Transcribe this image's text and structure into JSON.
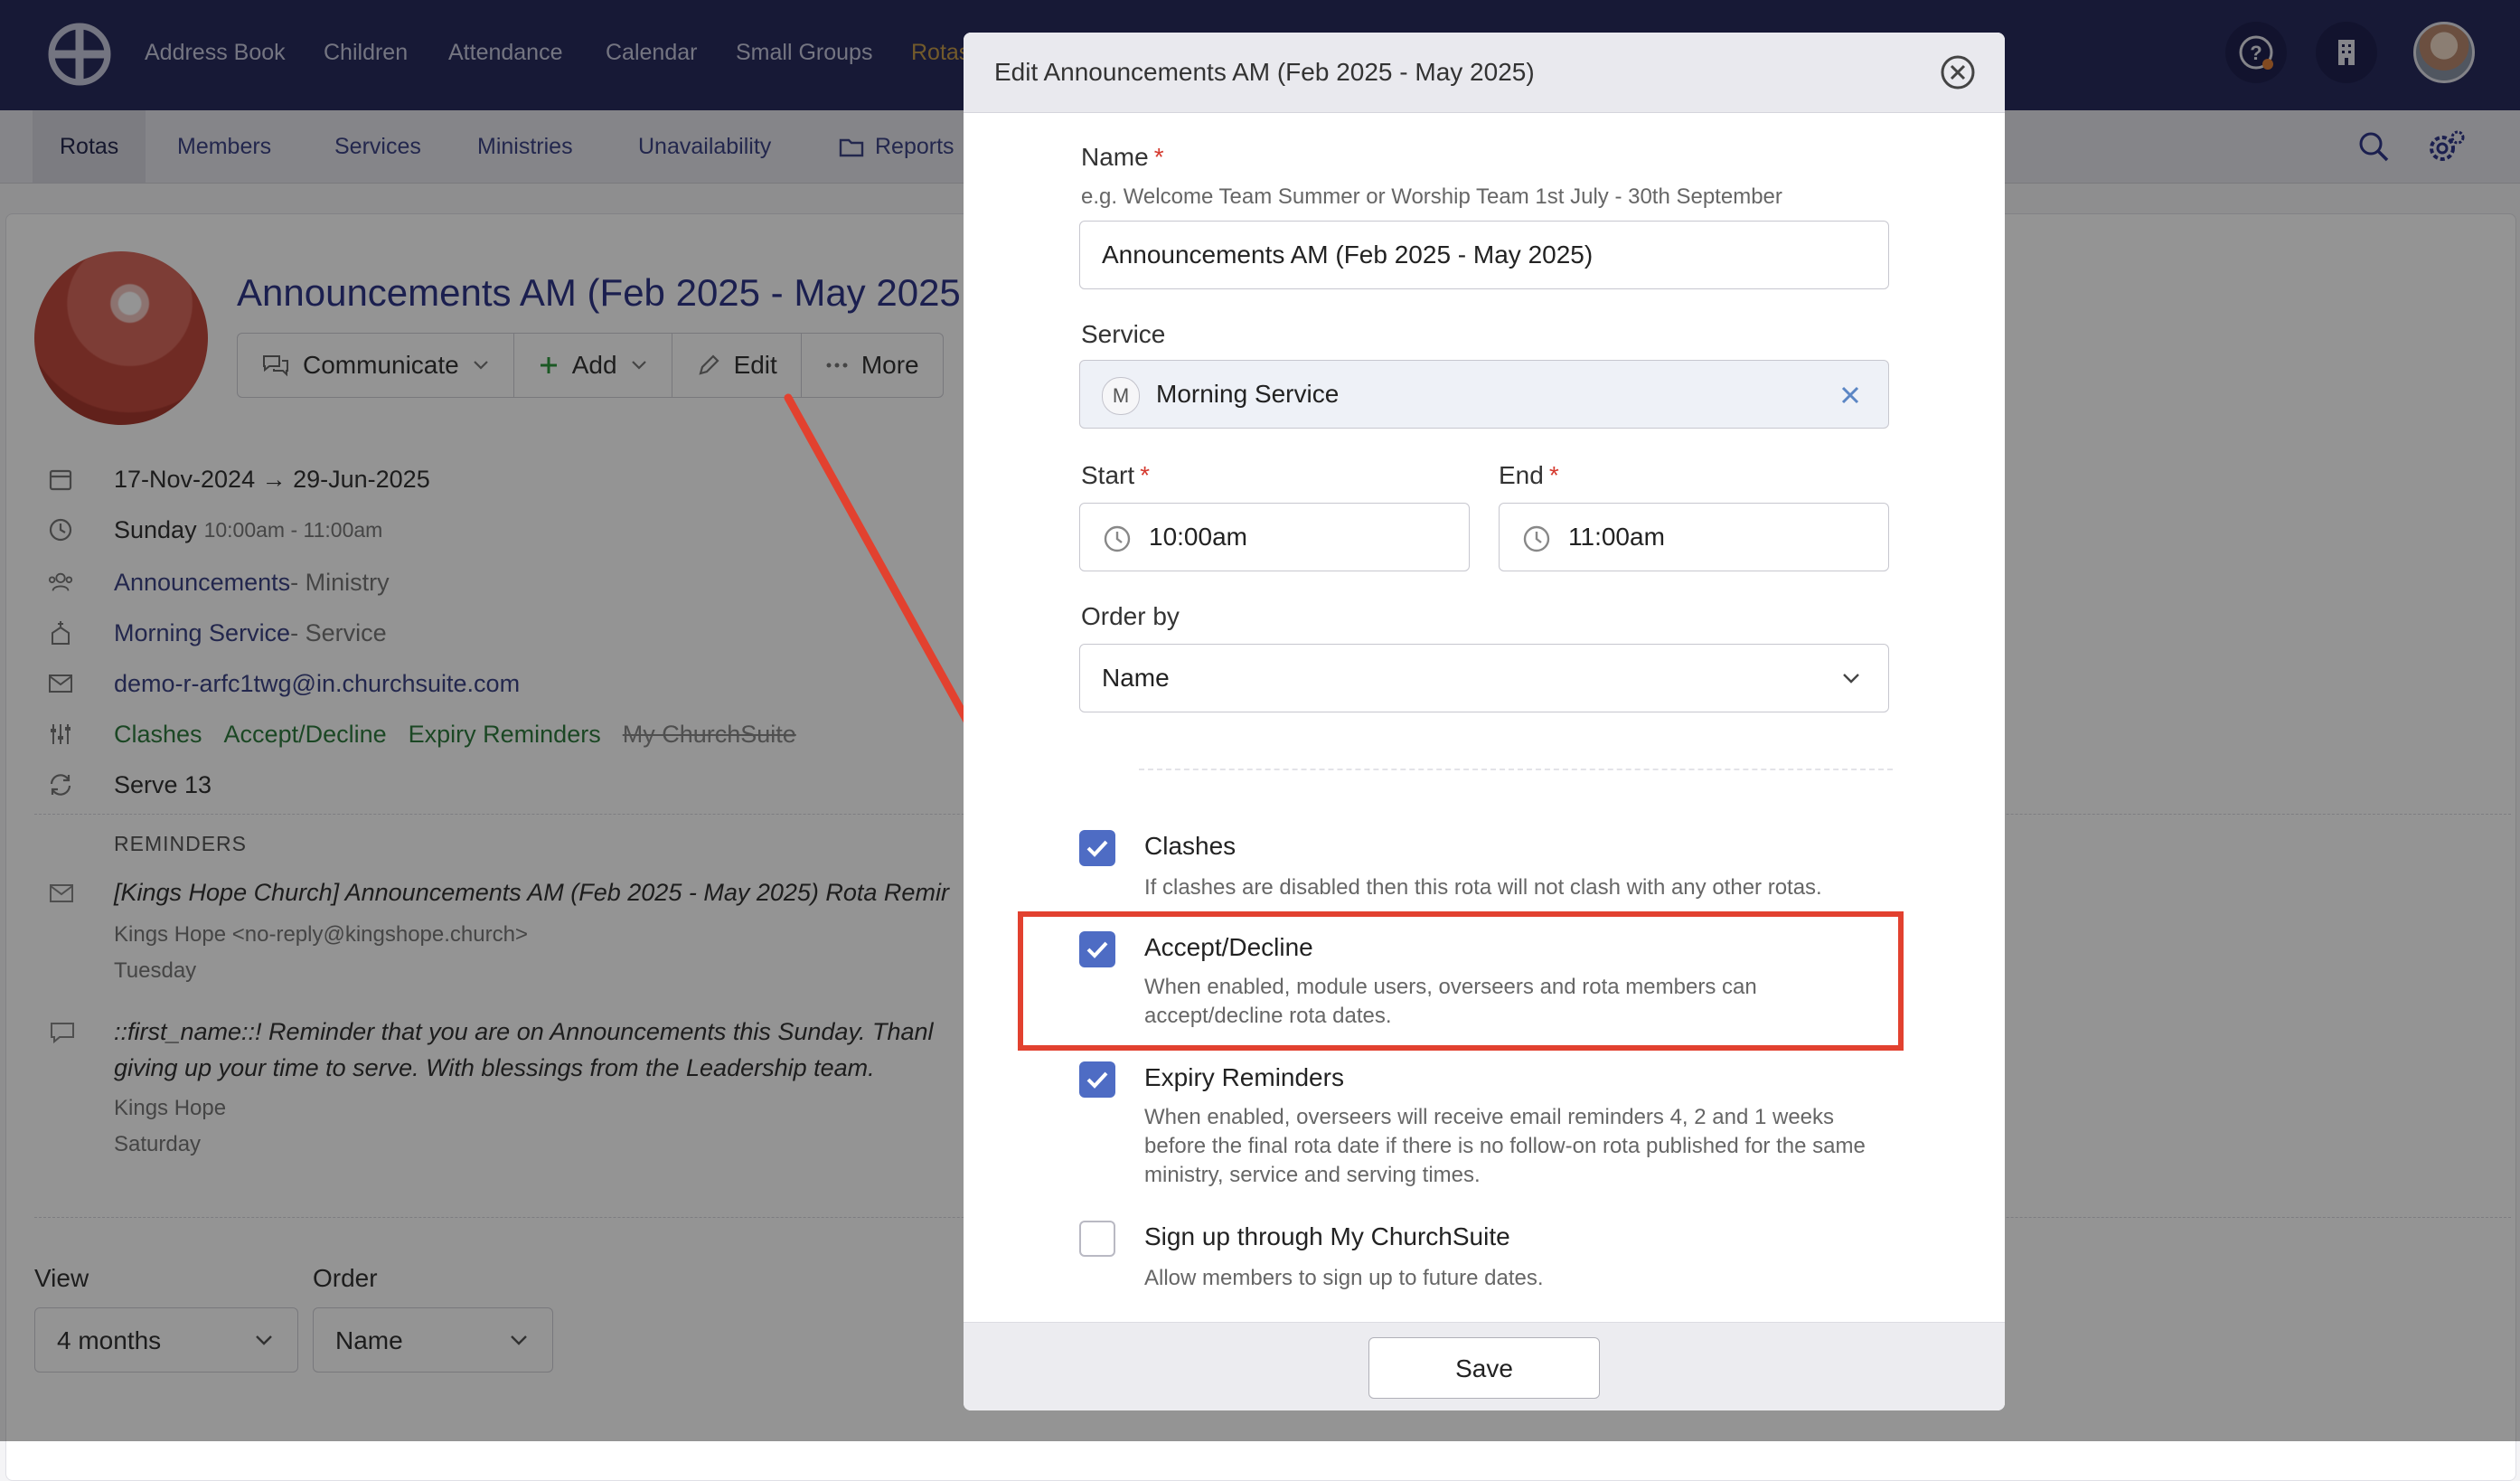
{
  "topnav": {
    "items": [
      "Address Book",
      "Children",
      "Attendance",
      "Calendar",
      "Small Groups",
      "Rotas"
    ],
    "help_icon": "help-icon",
    "building_icon": "building-icon"
  },
  "subnav": {
    "items": [
      "Rotas",
      "Members",
      "Services",
      "Ministries",
      "Unavailability",
      "Reports"
    ]
  },
  "rota": {
    "title": "Announcements AM (Feb 2025 - May 2025",
    "actions": [
      "Communicate",
      "Add",
      "Edit",
      "More"
    ],
    "dates": "17-Nov-2024 → 29-Jun-2025",
    "day": "Sunday",
    "time": "10:00am - 11:00am",
    "ministry_link": "Announcements",
    "ministry_suffix": " - Ministry",
    "service_link": "Morning Service",
    "service_suffix": " - Service",
    "email": "demo-r-arfc1twg@in.churchsuite.com",
    "features": [
      "Clashes",
      "Accept/Decline",
      "Expiry Reminders"
    ],
    "feature_disabled": "My ChurchSuite",
    "serve": "Serve 13",
    "reminders_label": "REMINDERS",
    "reminder1": {
      "subject": "[Kings Hope Church] Announcements AM (Feb 2025 - May 2025) Rota Remir",
      "from": "Kings Hope   <no-reply@kingshope.church>",
      "when": "Tuesday"
    },
    "reminder2": {
      "line1": "::first_name::! Reminder that you are on Announcements this Sunday. Thanl",
      "line2": "giving up your time to serve. With blessings from the Leadership team.",
      "from": "Kings Hope",
      "when": "Saturday"
    },
    "view_label": "View",
    "view_value": "4 months",
    "order_label": "Order",
    "order_value": "Name"
  },
  "modal": {
    "title": "Edit Announcements AM (Feb 2025 - May 2025)",
    "name_label": "Name",
    "name_help": "e.g. Welcome Team Summer or Worship Team 1st July - 30th September",
    "name_value": "Announcements AM (Feb 2025 - May 2025)",
    "service_label": "Service",
    "service_badge": "M",
    "service_value": "Morning Service",
    "start_label": "Start",
    "start_value": "10:00am",
    "end_label": "End",
    "end_value": "11:00am",
    "order_label": "Order by",
    "order_value": "Name",
    "required_mark": "*",
    "checkboxes": [
      {
        "label": "Clashes",
        "desc": "If clashes are disabled then this rota will not clash with any other rotas.",
        "checked": true
      },
      {
        "label": "Accept/Decline",
        "desc": "When enabled, module users, overseers and rota members can accept/decline rota dates.",
        "checked": true
      },
      {
        "label": "Expiry Reminders",
        "desc": "When enabled, overseers will receive email reminders 4, 2 and 1 weeks before the final rota date if there is no follow-on rota published for the same ministry, service and serving times.",
        "checked": true
      },
      {
        "label": "Sign up through My ChurchSuite",
        "desc": "Allow members to sign up to future dates.",
        "checked": false
      }
    ],
    "save_label": "Save"
  },
  "colors": {
    "nav_bg": "#292c5e",
    "accent": "#4e6cc4",
    "highlight": "#e2412f",
    "link": "#3d4486"
  }
}
